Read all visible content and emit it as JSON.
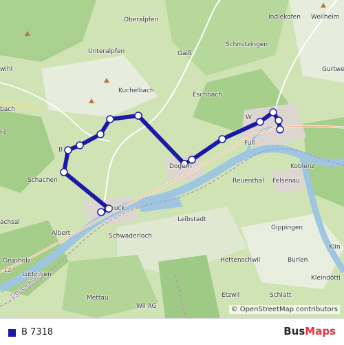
{
  "map": {
    "places": {
      "indlekofen": "Indlekofen",
      "weilheim": "Weilheim",
      "oberalpfen": "Oberalpfen",
      "unteralpfen": "Unteralpfen",
      "gaiss": "Gaiß",
      "schmitzingen": "Schmitzingen",
      "gurtweil": "Gurtwe",
      "wihl": "wihl",
      "bach": "bach",
      "hl": "hl",
      "kuchelbach": "Kuchelbach",
      "eschbach": "Eschbach",
      "buch": "B",
      "schachen": "Schachen",
      "dogern": "Dogern",
      "waldshut": "W",
      "full": "Full",
      "koblenz": "Koblenz",
      "reuenthal": "Reuenthal",
      "felsenau": "Felsenau",
      "sachsal": "achsal",
      "bruck": "ruck",
      "albert": "Albert",
      "schwaderloch": "Schwaderloch",
      "leibstadt": "Leibstadt",
      "gippingen": "Gippingen",
      "klingnau": "Klin",
      "grunholz": "Grunholz",
      "luttingen": "Luttingen",
      "hettenschwil": "Hettenschwil",
      "burlen": "Burlen",
      "kleindoettingen": "Kleindötti",
      "schlatt": "Schlatt",
      "etzwil": "Etzwil",
      "mettau": "Mettau",
      "wil_ag": "Wil AG",
      "deutschland": "Deutschland",
      "road_12": "12"
    },
    "attribution": "© OpenStreetMap contributors",
    "route_color": "#1a1aa6"
  },
  "legend": {
    "label": "B 7318",
    "color": "#1a1aa6"
  },
  "brand": {
    "part1": "Bus",
    "part2": "Maps"
  }
}
